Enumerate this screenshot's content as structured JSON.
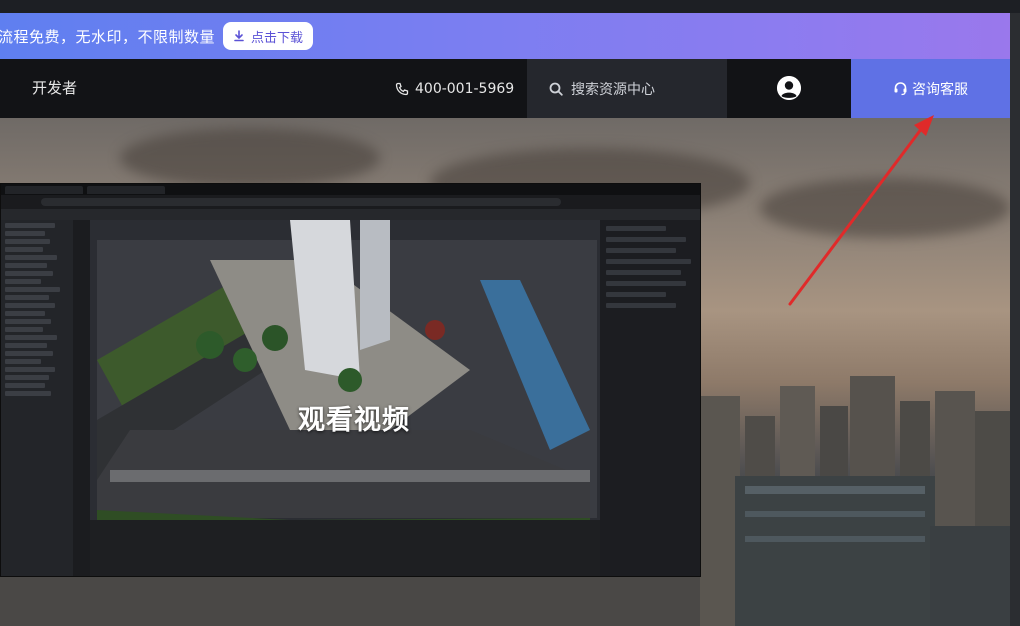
{
  "banner": {
    "text": "流程免费，无水印，不限制数量",
    "download_label": "点击下载"
  },
  "nav": {
    "brand": "开发者",
    "phone": "400-001-5969",
    "search_placeholder": "搜索资源中心",
    "service_label": "咨询客服"
  },
  "video": {
    "overlay_title": "观看视频"
  },
  "colors": {
    "banner_start": "#5f7ff0",
    "banner_end": "#9a78ec",
    "nav_bg": "#121316",
    "service_bg": "#5f71e5",
    "arrow": "#e02a2a"
  },
  "icons": {
    "download": "download-icon",
    "phone": "phone-icon",
    "search": "search-icon",
    "avatar": "user-avatar-icon",
    "service": "headset-icon"
  }
}
